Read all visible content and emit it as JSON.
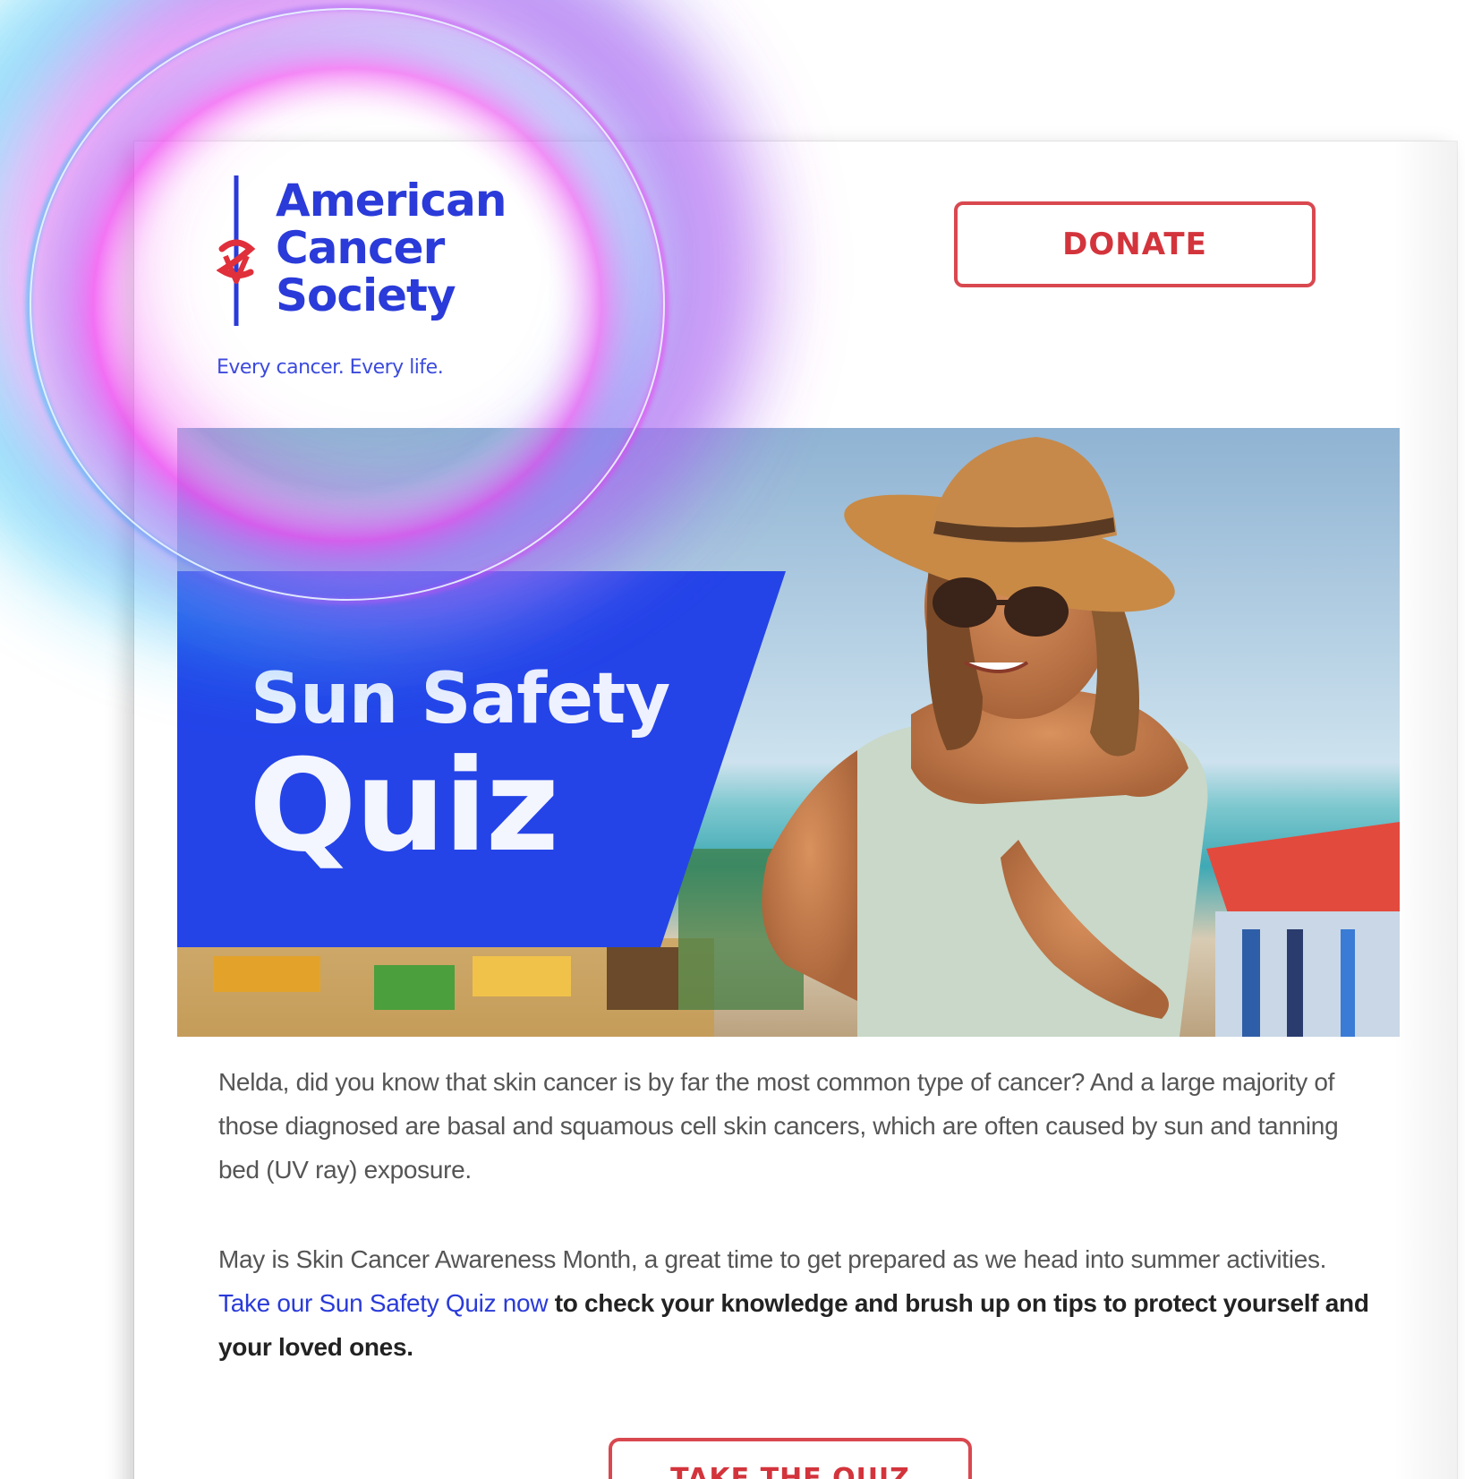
{
  "header": {
    "logo": {
      "line1": "American",
      "line2": "Cancer",
      "line3": "Society",
      "tagline": "Every cancer. Every life."
    },
    "donate_label": "DONATE"
  },
  "hero": {
    "title_line1": "Sun Safety",
    "title_line2": "Quiz"
  },
  "body": {
    "paragraph1": "Nelda, did you know that skin cancer is by far the most common type of cancer? And a large majority of those diagnosed are basal and squamous cell skin cancers, which are often caused by sun and tanning bed (UV ray) exposure.",
    "paragraph2_lead": "May is Skin Cancer Awareness Month, a great time to get prepared as we head into summer activities. ",
    "paragraph2_link": "Take our Sun Safety Quiz now",
    "paragraph2_bold": " to check your knowledge and brush up on tips to protect yourself and your loved ones."
  },
  "cta": {
    "label": "TAKE THE QUIZ"
  },
  "colors": {
    "brand_blue": "#2a3bd9",
    "banner_blue": "#2444e8",
    "cta_red": "#d3343c",
    "glow_cyan": "#22c6f5",
    "glow_magenta": "#ee3cf0"
  },
  "icons": {
    "logo_mark": "sword-caduceus-logo-icon"
  }
}
